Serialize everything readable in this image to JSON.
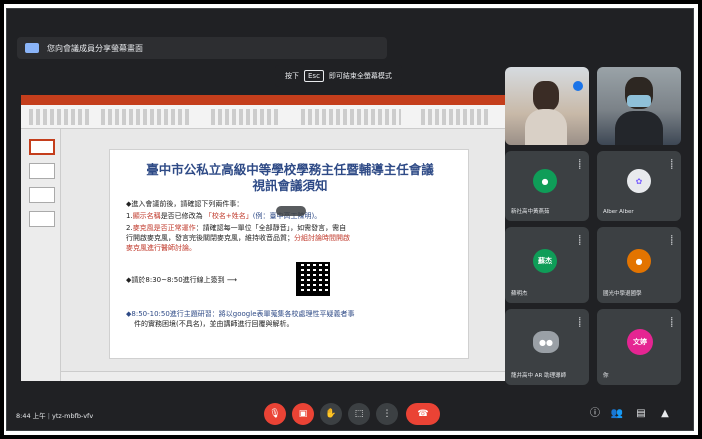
{
  "presenting": {
    "banner": "您向會議成員分享螢幕畫面"
  },
  "fullscreen_hint": {
    "prefix": "按下",
    "key": "Esc",
    "suffix": "即可結束全螢幕模式"
  },
  "slide": {
    "title_line1": "臺中市公私立高級中等學校學務主任暨輔導主任會議",
    "title_line2": "視訊會議須知",
    "intro": "◆進入會議前後，請確認下列兩件事：",
    "item1_prefix": "1.",
    "item1_highlight": "顯示名稱",
    "item1_text": "是否已修改為 ",
    "item1_blue": "「校名+姓名」",
    "item1_rest": "(例：臺中高工陳明)。",
    "item2_prefix": "2.",
    "item2_highlight": "麥克風是否正常運作",
    "item2_text": "：請確認每一單位「全部靜音」，如需發言，需自",
    "item2_line2": "行開啟麥克風，發言完後關閉麥克風，維持收音品質；",
    "item2_red2": "分組討論時間開啟",
    "item2_line3_red": "麥克風進行醫師討論。",
    "schedule1": "◆請於8:30~8:50進行線上簽到 ⟶",
    "schedule2": "◆8:50-10:50進行主題研習：將以google表單蒐集各校處理性平疑義者事",
    "schedule2_line2": "件的實務困境(不具名)，並由講師進行回覆與解析。"
  },
  "participants": [
    {
      "name": "",
      "type": "camera"
    },
    {
      "name": "",
      "type": "camera"
    },
    {
      "name": "新社高中黃燕茹",
      "initial": "",
      "color": "#0f9d58",
      "type": "avatar"
    },
    {
      "name": "Alber Alber",
      "initial": "",
      "color": "#e8eaed",
      "type": "avatar"
    },
    {
      "name": "蘇明杰",
      "initial": "蘇杰",
      "color": "#0f9d58",
      "type": "initials"
    },
    {
      "name": "國光中學退國學",
      "initial": "",
      "color": "#e37400",
      "type": "avatar"
    },
    {
      "name": "龍井高中 AR 助理導師",
      "initial": "",
      "color": "#9aa0a6",
      "type": "avatar"
    },
    {
      "name": "你",
      "initial": "文婷",
      "color": "#e52592",
      "type": "initials"
    }
  ],
  "bottom_bar": {
    "time": "8:44 上午",
    "meeting_code": "ytz-mbfb-vfv"
  },
  "icons": {
    "mic": "mic-off-icon",
    "camera": "camera-off-icon",
    "hand": "raise-hand-icon",
    "present": "present-icon",
    "more": "more-icon",
    "hangup": "hang-up-icon"
  },
  "colors": {
    "accent_red": "#ea4335",
    "slide_title": "#2e4a86",
    "highlight": "#c0392b"
  }
}
